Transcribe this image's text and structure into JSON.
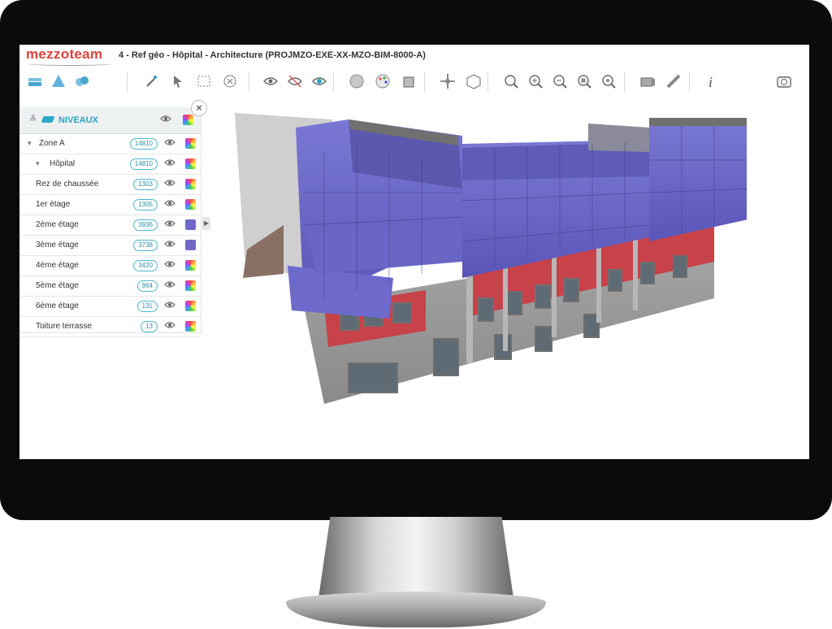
{
  "app": {
    "logo": "mezzoteam",
    "title": "4 - Ref géo - Hôpital - Architecture (PROJMZO-EXE-XX-MZO-BIM-8000-A)"
  },
  "toolbar": [
    {
      "icon": "levels-icon"
    },
    {
      "icon": "shapes-icon"
    },
    {
      "icon": "spheres-icon"
    },
    {
      "icon": "magic-select-icon"
    },
    {
      "icon": "pointer-select-icon"
    },
    {
      "icon": "box-select-icon"
    },
    {
      "icon": "clear-select-icon"
    },
    {
      "icon": "view-eye-icon"
    },
    {
      "icon": "hide-eye-icon"
    },
    {
      "icon": "isolate-eye-icon"
    },
    {
      "icon": "sphere-icon"
    },
    {
      "icon": "palette-icon"
    },
    {
      "icon": "section-box-icon"
    },
    {
      "icon": "move-icon"
    },
    {
      "icon": "cube-icon"
    },
    {
      "icon": "zoom-fit-icon"
    },
    {
      "icon": "zoom-in-icon"
    },
    {
      "icon": "zoom-out-icon"
    },
    {
      "icon": "zoom-window-icon"
    },
    {
      "icon": "zoom-all-icon"
    },
    {
      "icon": "camera-view-icon"
    },
    {
      "icon": "measure-icon"
    },
    {
      "icon": "info-icon"
    },
    {
      "icon": "screenshot-icon"
    }
  ],
  "panel": {
    "title": "NIVEAUX",
    "rows": [
      {
        "label": "Zone A",
        "count": "14810",
        "indent": 1,
        "arrow": "▾",
        "color": "rainbow"
      },
      {
        "label": "Hôpital",
        "count": "14810",
        "indent": 2,
        "arrow": "▾",
        "color": "rainbow"
      },
      {
        "label": "Rez de chaussée",
        "count": "1303",
        "indent": 3,
        "arrow": "",
        "color": "rainbow"
      },
      {
        "label": "1er étage",
        "count": "1305",
        "indent": 3,
        "arrow": "",
        "color": "rainbow"
      },
      {
        "label": "2ème étage",
        "count": "3936",
        "indent": 3,
        "arrow": "",
        "color": "#7068c8"
      },
      {
        "label": "3ème étage",
        "count": "3738",
        "indent": 3,
        "arrow": "",
        "color": "#7068c8"
      },
      {
        "label": "4ème étage",
        "count": "3420",
        "indent": 3,
        "arrow": "",
        "color": "rainbow"
      },
      {
        "label": "5ème étage",
        "count": "964",
        "indent": 3,
        "arrow": "",
        "color": "rainbow"
      },
      {
        "label": "6ème étage",
        "count": "131",
        "indent": 3,
        "arrow": "",
        "color": "rainbow"
      },
      {
        "label": "Toiture terrasse",
        "count": "13",
        "indent": 3,
        "arrow": "",
        "color": "rainbow"
      }
    ]
  },
  "colors": {
    "accent": "#2aa3c2",
    "brand": "#e0403a",
    "highlight": "#6a64c4",
    "facade_red": "#c8424a",
    "facade_grey": "#9a9a9a"
  }
}
